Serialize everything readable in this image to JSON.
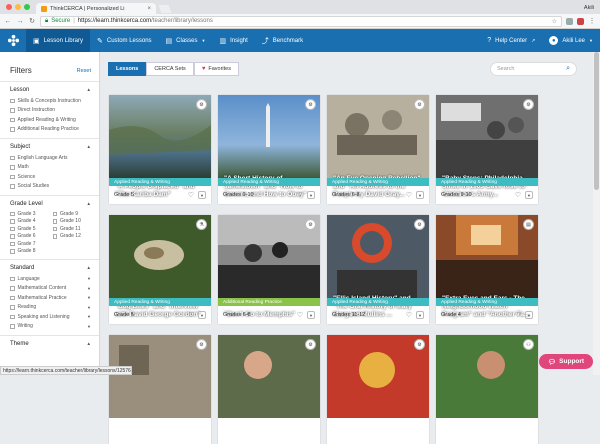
{
  "browser": {
    "tab_title": "ThinkCERCA | Personalized Li",
    "user": "Akili",
    "secure_label": "Secure",
    "url_domain": "https://learn.thinkcerca.com",
    "url_path": "/teacher/library/lessons",
    "status_url": "https://learn.thinkcerca.com/teacher/library/lessons/12576"
  },
  "nav": {
    "items": [
      {
        "label": "Lesson Library"
      },
      {
        "label": "Custom Lessons"
      },
      {
        "label": "Classes"
      },
      {
        "label": "Insight"
      },
      {
        "label": "Benchmark"
      }
    ],
    "help": "Help Center",
    "user": "Akili Lee"
  },
  "filters": {
    "title": "Filters",
    "reset": "Reset",
    "lesson": {
      "label": "Lesson",
      "options": [
        "Skills & Concepts Instruction",
        "Direct Instruction",
        "Applied Reading & Writing",
        "Additional Reading Practice"
      ]
    },
    "subject": {
      "label": "Subject",
      "options": [
        "English Language Arts",
        "Math",
        "Science",
        "Social Studies"
      ]
    },
    "grade": {
      "label": "Grade Level",
      "col1": [
        "Grade 3",
        "Grade 4",
        "Grade 5",
        "Grade 6",
        "Grade 7",
        "Grade 8"
      ],
      "col2": [
        "Grade 9",
        "Grade 10",
        "Grade 11",
        "Grade 12"
      ]
    },
    "standard": {
      "label": "Standard",
      "options": [
        "Language",
        "Mathematical Content",
        "Mathematical Practice",
        "Reading",
        "Speaking and Listening",
        "Writing"
      ]
    },
    "theme": {
      "label": "Theme"
    }
  },
  "tabs": {
    "lessons": "Lessons",
    "cerca": "CERCA Sets",
    "favorites": "Favorites"
  },
  "search": {
    "placeholder": "Search"
  },
  "cards": [
    {
      "title": "\"A People Displaced\" and \"The Kariba Dam\"",
      "category": "Applied Reading & Writing",
      "grade": "Grade 5"
    },
    {
      "title": "\"A Short History of Jamestown\" and \"How to Govern, and How to Obey\"",
      "category": "Applied Reading & Writing",
      "grade": "Grades 9-10"
    },
    {
      "title": "\"An Eye Opening Rebellion\" and \"An Address to the People by David Gray...",
      "category": "Applied Reading & Writing",
      "grade": "Grades 6-8"
    },
    {
      "title": "\"Baby Steps: Philadelphia Strike in 1903 Gave Rise to 'Children's Army...",
      "category": "Applied Reading & Writing",
      "grade": "Grades 9-10"
    },
    {
      "title": "\"Bug Bites\" and \"Interview with David George Gordon\"",
      "category": "Applied Reading & Writing",
      "grade": "Grade 5"
    },
    {
      "title": "\"Don't Go to Memphis\"",
      "category": "Additional Reading Practice",
      "grade": "Grades 6-8"
    },
    {
      "title": "\"Ellis Island History\" and \"The Oral History of Mary Margaret Mullins ...",
      "category": "Applied Reading & Writing",
      "grade": "Grades 11-12"
    },
    {
      "title": "\"Extra Eyes and Ears - The Neighborhood Watch Program\" and \"Another Ta...",
      "category": "Applied Reading & Writing",
      "grade": "Grade 4"
    }
  ],
  "support": "Support",
  "colors": {
    "brand": "#1a6fb0",
    "category": "#3dbcc2",
    "category_alt": "#8bc34a",
    "support": "#e0457b"
  }
}
